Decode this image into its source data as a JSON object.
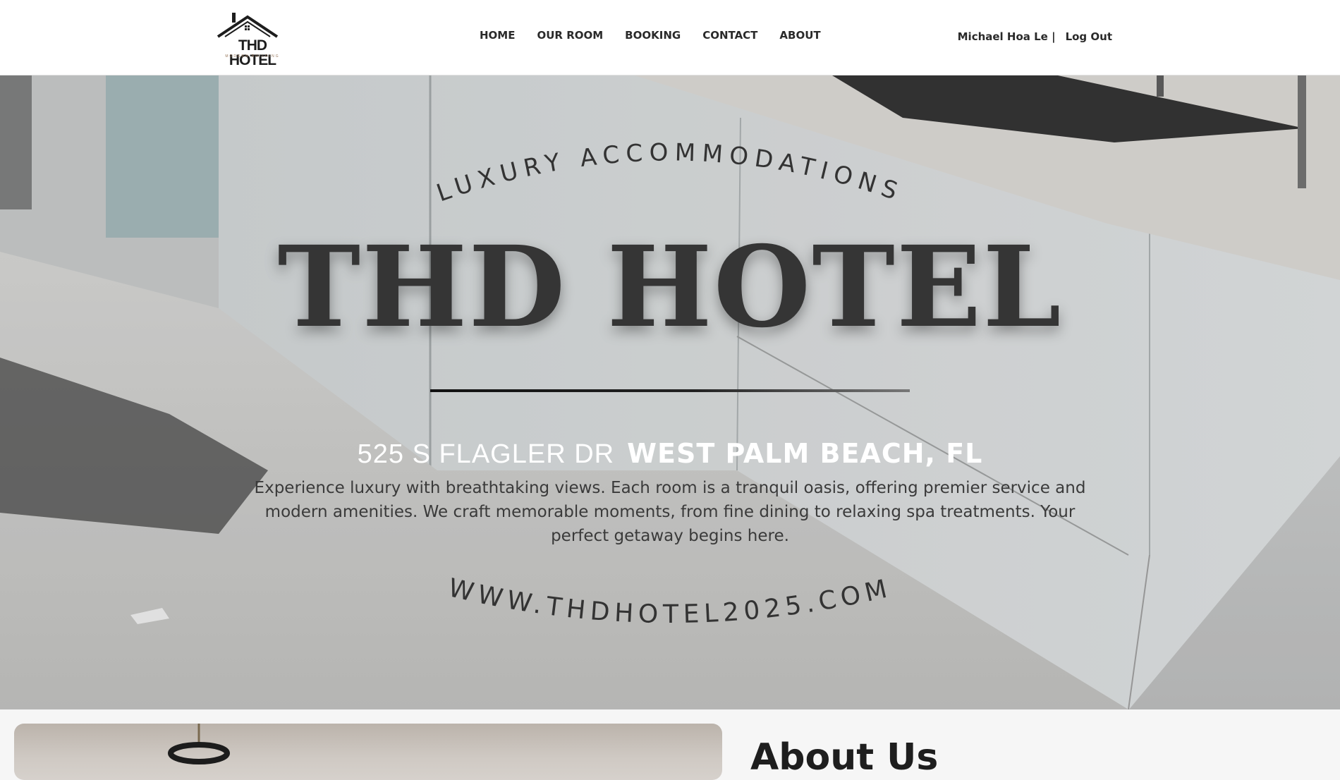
{
  "header": {
    "logo": {
      "name": "THD HOTEL",
      "tagline": "MODERN BUILDING"
    },
    "nav": [
      "HOME",
      "OUR ROOM",
      "BOOKING",
      "CONTACT",
      "ABOUT"
    ],
    "user": {
      "name": "Michael Hoa Le |",
      "logout": "Log Out"
    }
  },
  "hero": {
    "subtitle": "LUXURY ACCOMMODATIONS",
    "title": "THD HOTEL",
    "address": {
      "street": "525 S FLAGLER DR",
      "city": "WEST PALM BEACH, FL"
    },
    "description": "Experience luxury with breathtaking views. Each room is a tranquil oasis, offering premier service and modern amenities. We craft memorable moments, from fine dining to relaxing spa treatments. Your perfect getaway begins here.",
    "website": "WWW.THDHOTEL2025.COM"
  },
  "about": {
    "heading": "About Us"
  },
  "colors": {
    "header_bg": "#ffffff",
    "title": "#353535",
    "address": "#ffffff",
    "text": "#2a2a2a"
  }
}
